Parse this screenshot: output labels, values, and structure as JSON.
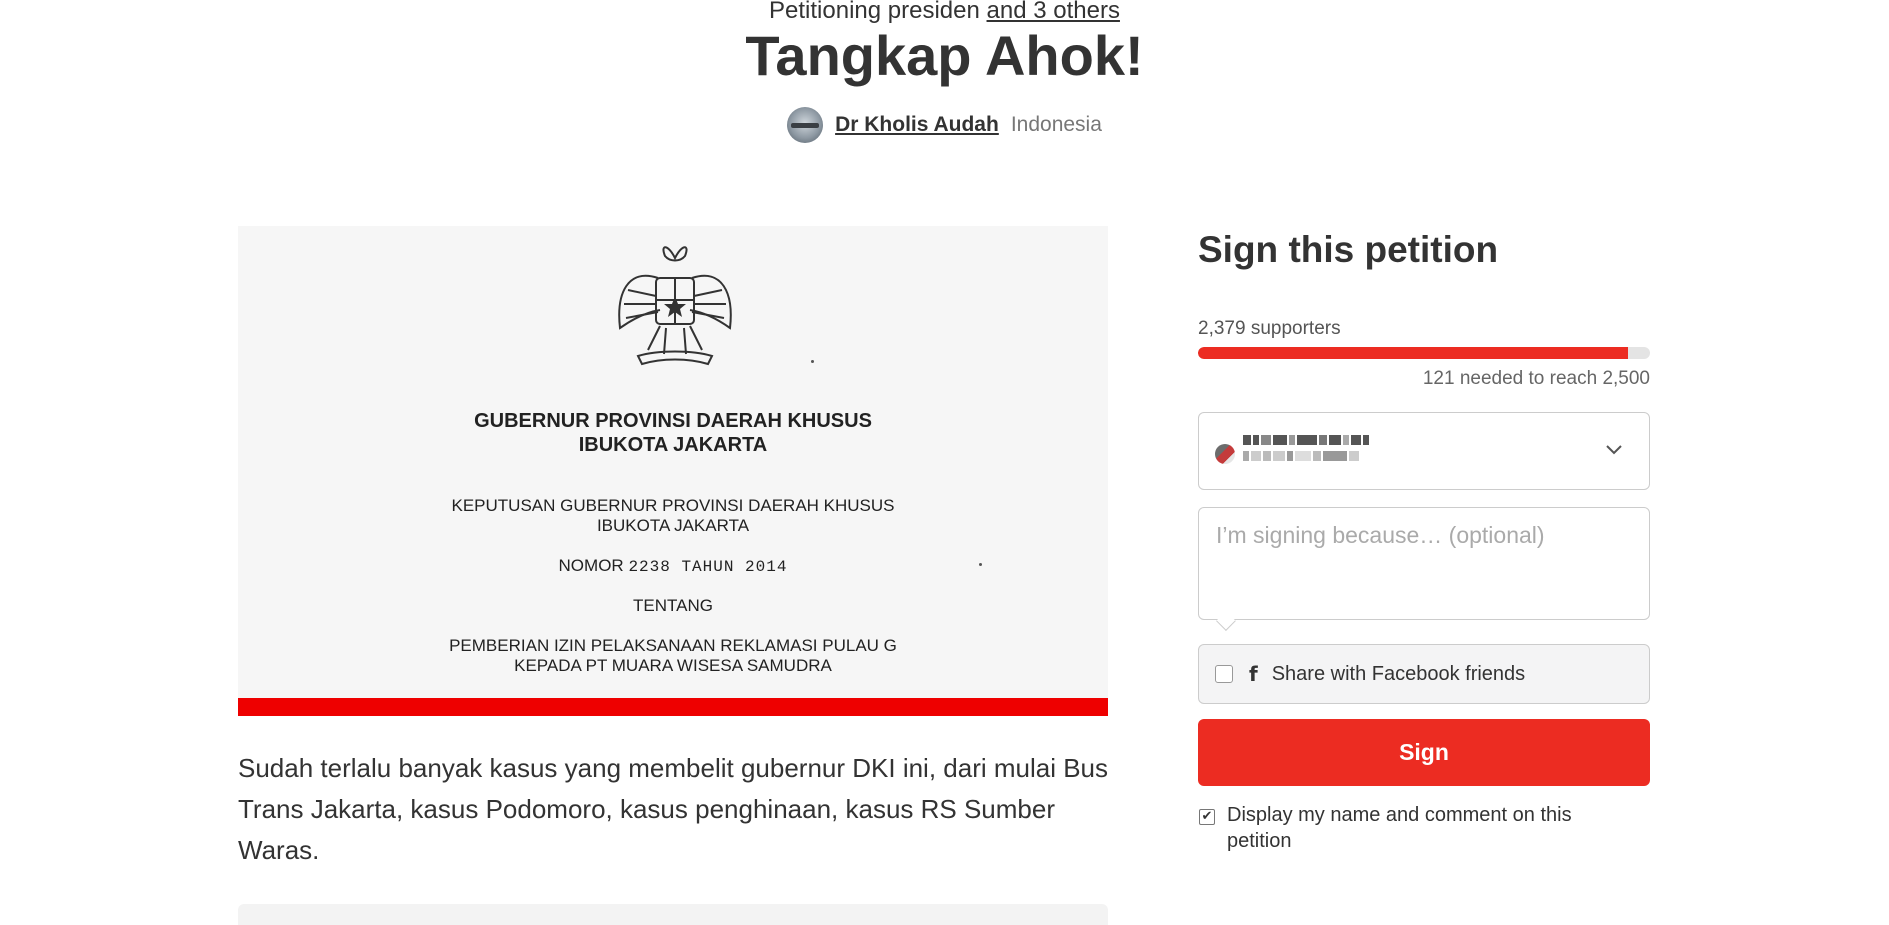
{
  "header": {
    "petitioning_prefix": "Petitioning presiden",
    "petitioning_others": "and 3 others",
    "title": "Tangkap Ahok!",
    "author_name": "Dr Kholis Audah",
    "author_country": "Indonesia"
  },
  "media": {
    "heading_line1": "GUBERNUR PROVINSI DAERAH KHUSUS",
    "heading_line2": "IBUKOTA JAKARTA",
    "decree_line1": "KEPUTUSAN GUBERNUR PROVINSI DAERAH KHUSUS",
    "decree_line2": "IBUKOTA JAKARTA",
    "nomor_label": "NOMOR",
    "nomor_value": "2238 TAHUN 2014",
    "tentang": "TENTANG",
    "subject_line1": "PEMBERIAN IZIN PELAKSANAAN REKLAMASI PULAU G",
    "subject_line2": "KEPADA PT MUARA WISESA SAMUDRA",
    "accent_color": "#ee0000"
  },
  "description": "Sudah terlalu banyak kasus yang membelit gubernur DKI ini, dari mulai Bus Trans Jakarta, kasus Podomoro, kasus penghinaan, kasus RS Sumber Waras.",
  "sign": {
    "title": "Sign this petition",
    "supporters_text": "2,379 supporters",
    "progress_fraction": 0.9516,
    "progress_caption": "121 needed to reach 2,500",
    "comment_placeholder": "I’m signing because… (optional)",
    "facebook_icon": "f",
    "facebook_label": "Share with Facebook friends",
    "sign_button": "Sign",
    "display_check": "✔",
    "display_label": "Display my name and comment on this petition",
    "brand_color": "#ec2c22"
  }
}
